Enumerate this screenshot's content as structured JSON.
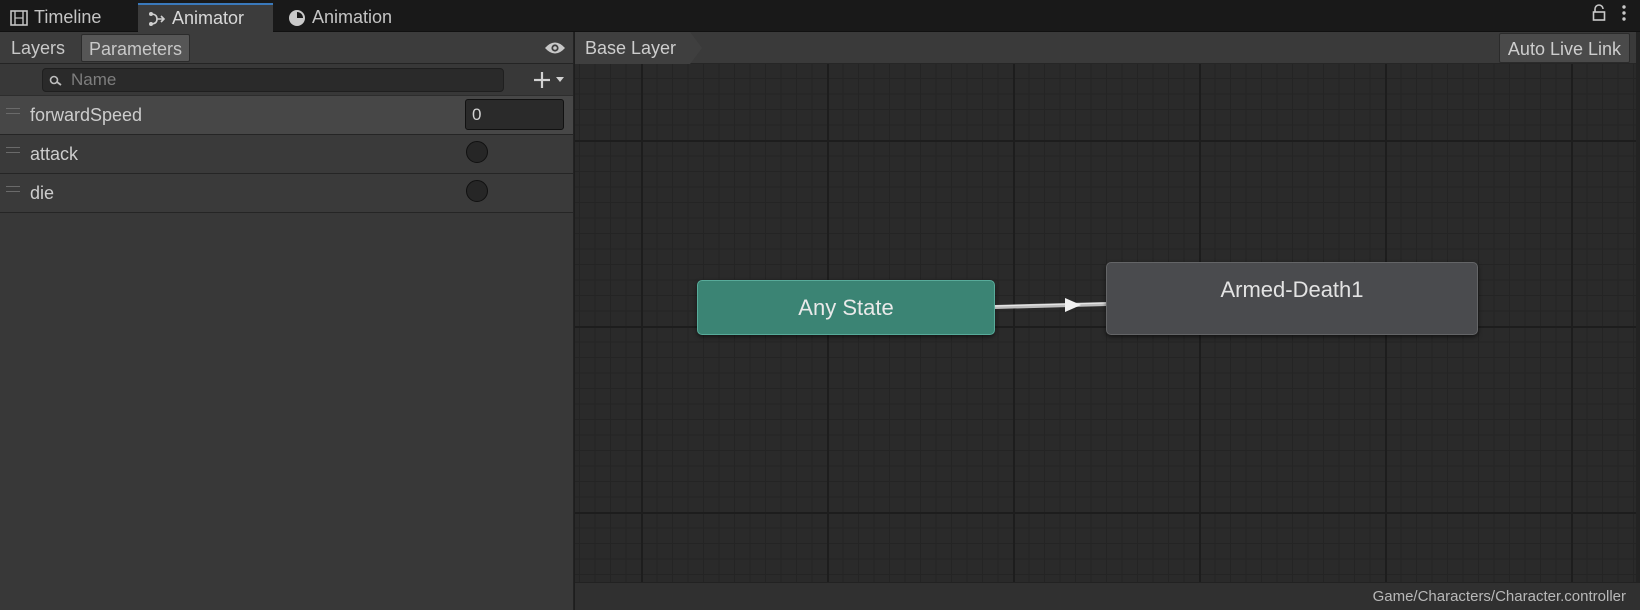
{
  "tabs": [
    {
      "label": "Timeline",
      "icon": "film-icon"
    },
    {
      "label": "Animator",
      "icon": "animator-icon",
      "active": true
    },
    {
      "label": "Animation",
      "icon": "clock-icon"
    }
  ],
  "left_panel": {
    "toolbar": {
      "layers_label": "Layers",
      "parameters_label": "Parameters"
    },
    "search": {
      "placeholder": "Name",
      "value": ""
    },
    "parameters": [
      {
        "name": "forwardSpeed",
        "type": "float",
        "value": "0"
      },
      {
        "name": "attack",
        "type": "trigger"
      },
      {
        "name": "die",
        "type": "trigger"
      }
    ]
  },
  "graph": {
    "breadcrumb": "Base Layer",
    "live_link_label": "Auto Live Link",
    "states": {
      "any_state": "Any State",
      "armed_death": "Armed-Death1"
    },
    "footer_path": "Game/Characters/Character.controller"
  },
  "colors": {
    "accent_tab": "#3a79bb",
    "any_state": "#3b8474",
    "normal_state": "#4a4b4e",
    "graph_bg": "#2a2a2a"
  }
}
